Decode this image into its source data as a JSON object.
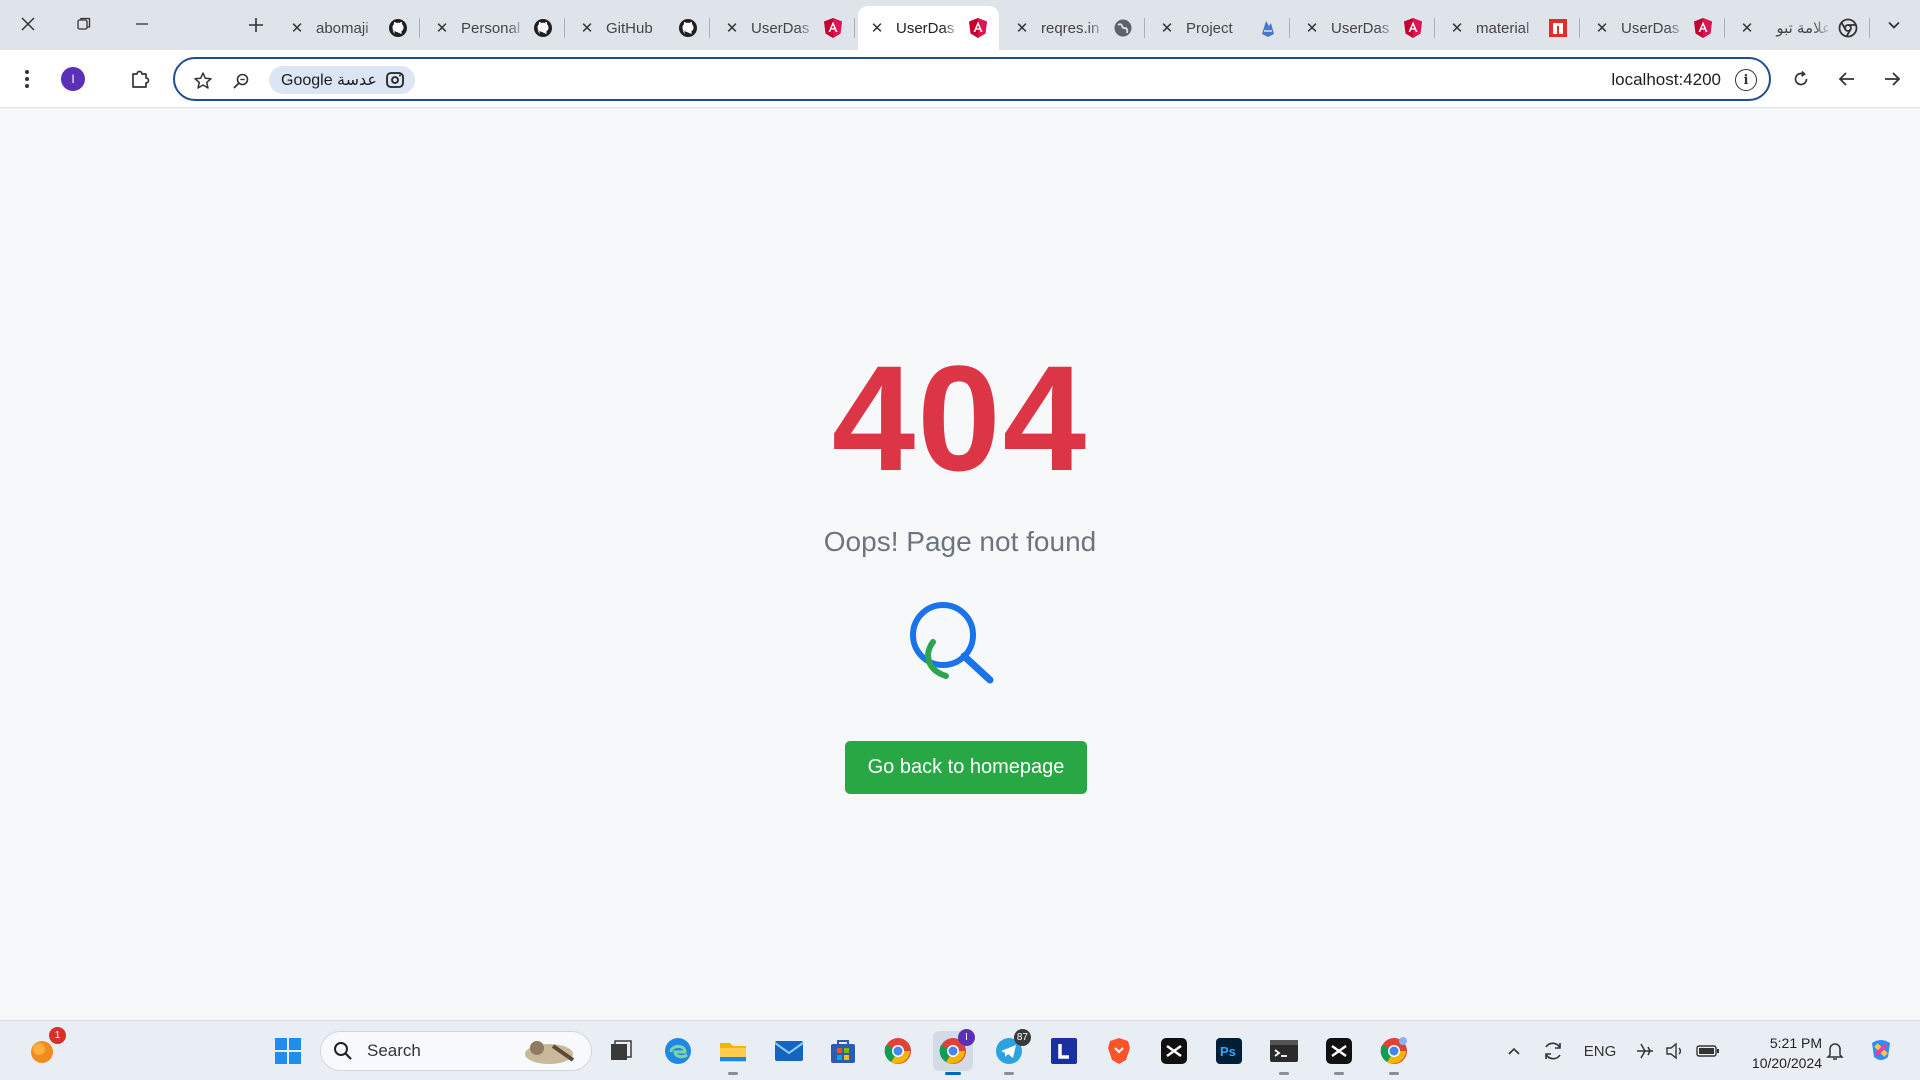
{
  "browser": {
    "tabs": [
      {
        "title": "abomaji",
        "icon": "github-icon"
      },
      {
        "title": "Personal",
        "icon": "github-icon"
      },
      {
        "title": "GitHub",
        "icon": "github-icon"
      },
      {
        "title": "UserDas",
        "icon": "angular-icon"
      },
      {
        "title": "UserDas",
        "icon": "angular-icon",
        "active": true
      },
      {
        "title": "reqres.in",
        "icon": "globe-icon"
      },
      {
        "title": "Project",
        "icon": "firebase-icon"
      },
      {
        "title": "UserDas",
        "icon": "angular-icon"
      },
      {
        "title": "material",
        "icon": "material-icon"
      },
      {
        "title": "UserDas",
        "icon": "angular-icon"
      },
      {
        "title": "علامة تبو",
        "icon": "chrome-icon"
      }
    ],
    "profile_initial": "I",
    "lens_label": "Google عدسة",
    "url": "localhost:4200"
  },
  "page": {
    "error_code": "404",
    "message": "Oops! Page not found",
    "button_label": "Go back to homepage",
    "accent_color": "#dc3545",
    "button_color": "#28a745"
  },
  "taskbar": {
    "search_placeholder": "Search",
    "widget_badge": "1",
    "chrome_badge": "I",
    "telegram_badge": "87",
    "language": "ENG",
    "time": "5:21 PM",
    "date": "10/20/2024"
  }
}
